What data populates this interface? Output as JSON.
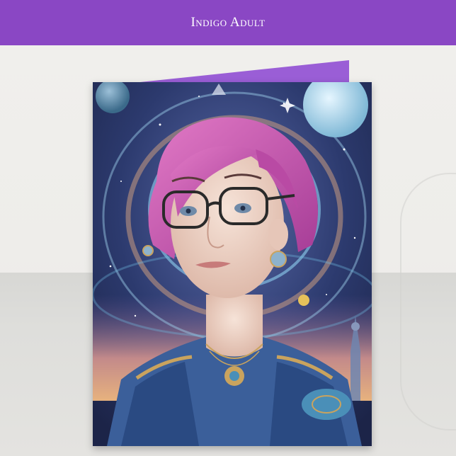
{
  "banner": {
    "title": "Indigo Adult"
  },
  "palette": {
    "banner": "#8a47c4",
    "card_back": "#9a5ed6",
    "hair": "#c04fa8",
    "sky": "#2a3560",
    "skin": "#efd6c8",
    "robe": "#3b5f9a",
    "gold": "#c9a35e"
  },
  "artwork": {
    "subject": "portrait-of-woman-with-pink-hair-and-glasses",
    "elements": [
      "celestial-ring",
      "planets",
      "stars",
      "tower"
    ]
  }
}
